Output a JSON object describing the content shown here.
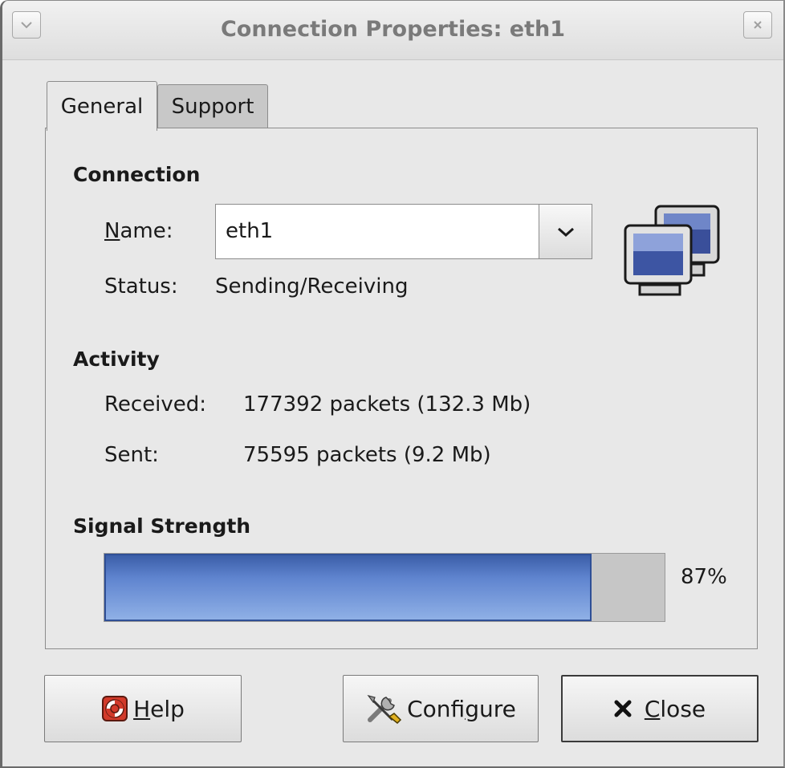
{
  "window": {
    "title": "Connection Properties: eth1"
  },
  "tabs": [
    {
      "label": "General",
      "selected": true
    },
    {
      "label": "Support",
      "selected": false
    }
  ],
  "connection": {
    "section_title": "Connection",
    "name_label_prefix": "N",
    "name_label_rest": "ame:",
    "name_value": "eth1",
    "status_label": "Status:",
    "status_value": "Sending/Receiving"
  },
  "activity": {
    "section_title": "Activity",
    "received_label": "Received:",
    "received_value": "177392 packets (132.3 Mb)",
    "sent_label": "Sent:",
    "sent_value": "75595 packets (9.2 Mb)"
  },
  "signal": {
    "section_title": "Signal Strength",
    "percent_text": "87%",
    "level": 0.87,
    "fill_color": "#5f84cf"
  },
  "buttons": {
    "help_mnemonic": "H",
    "help_rest": "elp",
    "configure_pre": "Confi",
    "configure_mnemonic": "g",
    "configure_rest": "ure",
    "close_mnemonic": "C",
    "close_rest": "lose"
  },
  "icons": {
    "menu": "chevron-down-icon",
    "close": "close-icon",
    "network": "network-computers-icon",
    "help": "lifebuoy-icon",
    "configure": "tools-icon",
    "close_button": "x-icon"
  }
}
